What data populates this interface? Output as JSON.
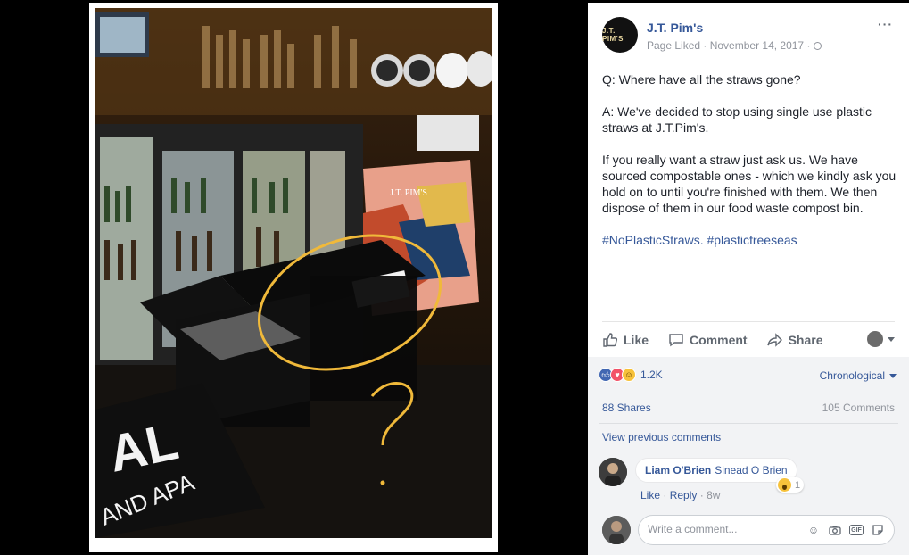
{
  "post": {
    "page_name": "J.T. Pim's",
    "avatar_text": "J.T. PIM'S",
    "meta": "Page Liked · November 14, 2017 ·",
    "more_label": "···",
    "paragraphs": [
      "Q: Where have all the straws gone?",
      "A: We've decided to stop using single use plastic straws at J.T.Pim's.",
      "If you really want a straw just ask us. We have sourced compostable ones - which we kindly ask you hold on to until you're finished with them. We then dispose of them in our food waste compost bin."
    ],
    "hashtags": [
      "#NoPlasticStraws.",
      "#plasticfreeseas"
    ]
  },
  "actions": {
    "like": "Like",
    "comment": "Comment",
    "share": "Share"
  },
  "stats": {
    "reactions_count": "1.2K",
    "sort_label": "Chronological",
    "shares": "88 Shares",
    "comments": "105 Comments"
  },
  "comments": {
    "view_previous": "View previous comments",
    "items": [
      {
        "author": "Liam O'Brien",
        "mention": "Sinead O Brien",
        "reaction_count": "1",
        "like_label": "Like",
        "reply_label": "Reply",
        "age": "8w"
      }
    ],
    "compose_placeholder": "Write a comment..."
  },
  "photo": {
    "menu_letters": "AL",
    "mat_text": "AND APA",
    "menu_card": "J.T. PIM'S"
  },
  "colors": {
    "link": "#365899",
    "muted": "#90949c",
    "annotation": "#f0b93a"
  },
  "icons": [
    "like-icon",
    "comment-icon",
    "share-icon",
    "globe-icon",
    "emoji-icon",
    "camera-icon",
    "gif-icon",
    "sticker-icon"
  ]
}
